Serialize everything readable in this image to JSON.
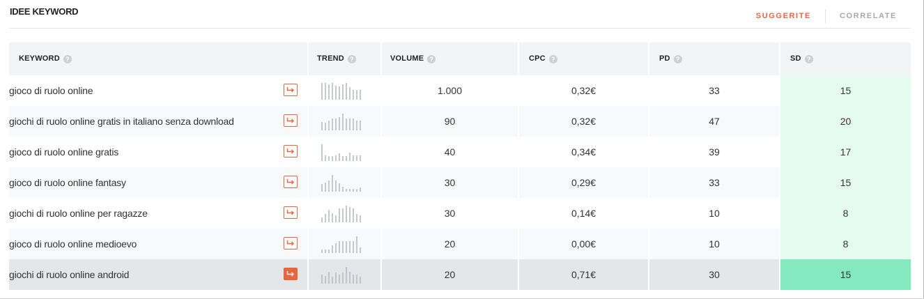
{
  "header": {
    "title": "IDEE KEYWORD",
    "tabs": [
      {
        "label": "SUGGERITE",
        "active": true
      },
      {
        "label": "CORRELATE",
        "active": false
      }
    ]
  },
  "table": {
    "columns": [
      {
        "label": "KEYWORD",
        "help": "?"
      },
      {
        "label": "TREND",
        "help": "?"
      },
      {
        "label": "VOLUME",
        "help": "?"
      },
      {
        "label": "CPC",
        "help": "?"
      },
      {
        "label": "PD",
        "help": "?"
      },
      {
        "label": "SD",
        "help": "?"
      }
    ],
    "rows": [
      {
        "keyword": "gioco di ruolo online",
        "volume": "1.000",
        "cpc": "0,32€",
        "pd": "33",
        "sd": "15",
        "trend": [
          1,
          1,
          0.9,
          1,
          0.85,
          0.8,
          0.9,
          1,
          0.75,
          0.6,
          0.6,
          0.6
        ]
      },
      {
        "keyword": "giochi di ruolo online gratis in italiano senza download",
        "volume": "90",
        "cpc": "0,32€",
        "pd": "47",
        "sd": "20",
        "trend": [
          0.5,
          0.45,
          0.6,
          0.7,
          0.7,
          0.8,
          1,
          0.7,
          0.7,
          0.7,
          0.6,
          0.6
        ]
      },
      {
        "keyword": "gioco di ruolo online gratis",
        "volume": "40",
        "cpc": "0,34€",
        "pd": "39",
        "sd": "17",
        "trend": [
          1,
          0.35,
          0.3,
          0.3,
          0.35,
          0.45,
          0.3,
          0.3,
          0.5,
          0.35,
          0.35,
          0.35
        ]
      },
      {
        "keyword": "gioco di ruolo online fantasy",
        "volume": "30",
        "cpc": "0,29€",
        "pd": "33",
        "sd": "15",
        "trend": [
          0.45,
          0.55,
          0.65,
          1,
          0.65,
          0.5,
          0.3,
          0.15,
          0.15,
          0.15,
          0.15,
          0.25
        ]
      },
      {
        "keyword": "giochi di ruolo online per ragazze",
        "volume": "30",
        "cpc": "0,14€",
        "pd": "10",
        "sd": "8",
        "trend": [
          0.3,
          0.5,
          0.75,
          0.55,
          0.4,
          0.85,
          0.85,
          1,
          0.9,
          0.85,
          0.5,
          0.4
        ]
      },
      {
        "keyword": "gioco di ruolo online medioevo",
        "volume": "20",
        "cpc": "0,00€",
        "pd": "10",
        "sd": "8",
        "trend": [
          0.2,
          0.2,
          0.2,
          0.45,
          0.6,
          0.7,
          0.7,
          0.7,
          0.7,
          0.7,
          1,
          0.35
        ]
      },
      {
        "keyword": "giochi di ruolo online android",
        "volume": "20",
        "cpc": "0,71€",
        "pd": "30",
        "sd": "15",
        "selected": true,
        "trend": [
          0.55,
          0.45,
          0.7,
          0.4,
          0.65,
          0.55,
          0.65,
          1,
          0.7,
          0.55,
          0.55,
          0.4
        ]
      }
    ]
  },
  "colors": {
    "accent": "#e8663d",
    "sd_bg": "#e6fbef",
    "sd_selected_bg": "#85e9bf",
    "trend_bar": "#c6c9cc"
  },
  "icons": {
    "row_action": "arrow-turn-right-icon",
    "column_help": "question-circle-icon"
  }
}
